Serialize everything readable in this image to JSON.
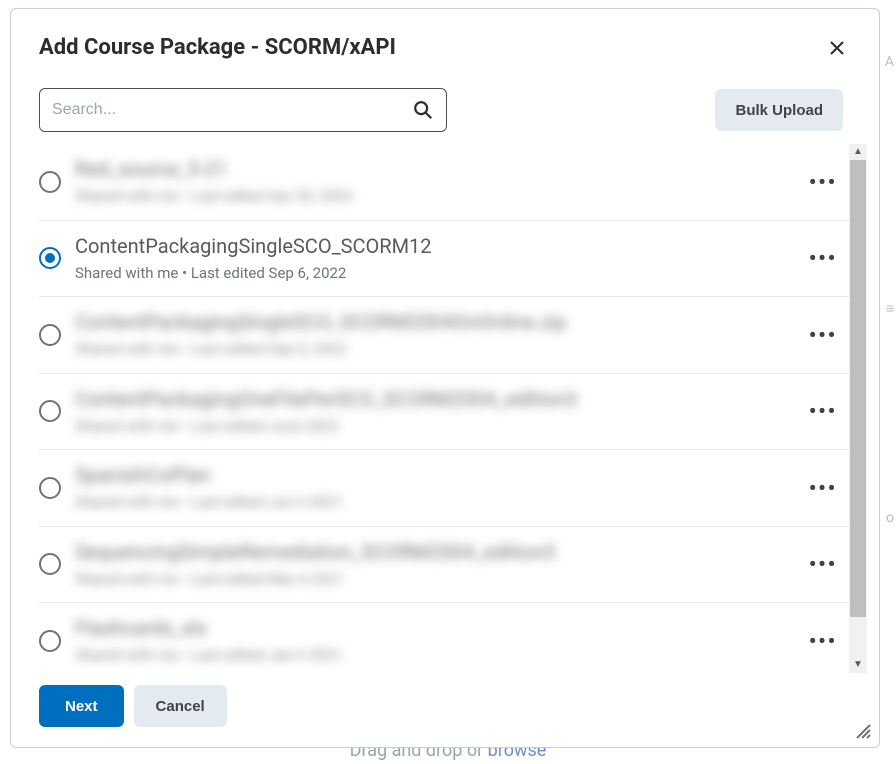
{
  "bg": {
    "hint_prefix": "Drag and drop or ",
    "hint_link": "browse"
  },
  "modal": {
    "title": "Add Course Package - SCORM/xAPI"
  },
  "search": {
    "placeholder": "Search..."
  },
  "toolbar": {
    "bulk_upload_label": "Bulk Upload"
  },
  "footer": {
    "next_label": "Next",
    "cancel_label": "Cancel"
  },
  "list": {
    "items": [
      {
        "title": "Red_source_5-21",
        "subtitle": "Shared with me • Last edited Apr 30, 2023",
        "selected": false,
        "blurred": true
      },
      {
        "title": "ContentPackagingSingleSCO_SCORM12",
        "subtitle": "Shared with me • Last edited Sep 6, 2022",
        "selected": true,
        "blurred": false
      },
      {
        "title": "ContentPackagingSingleSCO_SCORM2004OnOnline.zip",
        "subtitle": "Shared with me • Last edited Sep 5, 2022",
        "selected": false,
        "blurred": true
      },
      {
        "title": "ContentPackagingOneFilePerSCO_SCORM2004_edition3",
        "subtitle": "Shared with me • Last edited June 2022",
        "selected": false,
        "blurred": true
      },
      {
        "title": "SpanishCoPlan",
        "subtitle": "Shared with me • Last edited Jun 6 2021",
        "selected": false,
        "blurred": true
      },
      {
        "title": "SequencingSimpleRemediation_SCORM2004_edition3",
        "subtitle": "Shared with me • Last edited Mar 6 2021",
        "selected": false,
        "blurred": true
      },
      {
        "title": "Flashcards_xls",
        "subtitle": "Shared with me • Last edited Jan 6 2021",
        "selected": false,
        "blurred": true
      }
    ]
  }
}
